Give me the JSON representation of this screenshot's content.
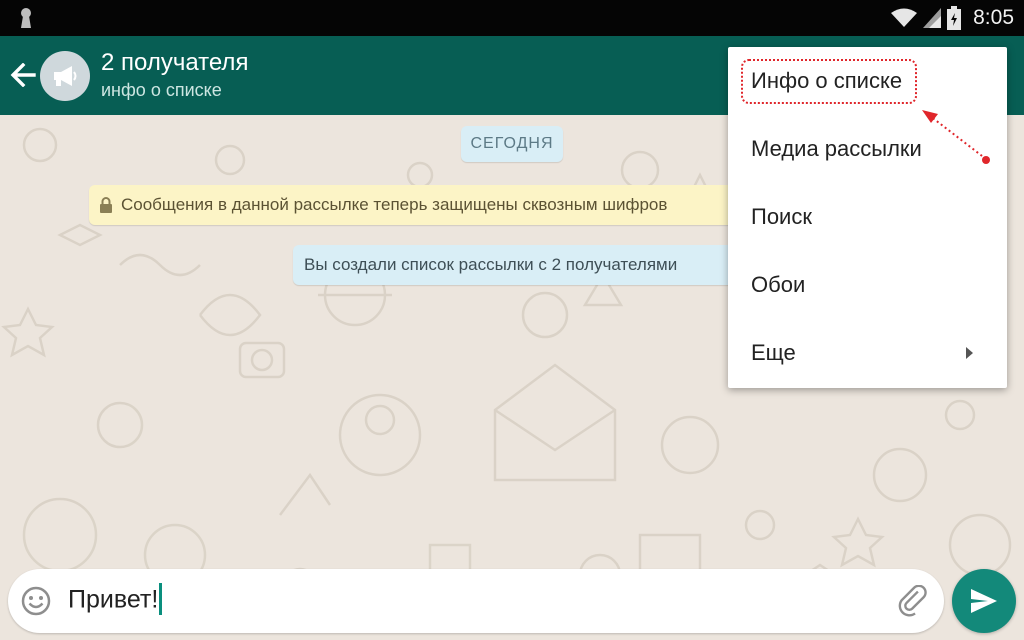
{
  "status_bar": {
    "time": "8:05",
    "icons": [
      "keyhole-icon",
      "wifi-icon",
      "signal-icon",
      "battery-icon"
    ]
  },
  "toolbar": {
    "back_icon": "arrow-left-icon",
    "avatar_icon": "broadcast-megaphone-icon",
    "title": "2 получателя",
    "subtitle": "инфо о списке"
  },
  "chat": {
    "date_chip": "СЕГОДНЯ",
    "encryption_notice": "Сообщения в данной рассылке теперь защищены сквозным шифров",
    "system_message": "Вы создали список рассылки с 2 получателями"
  },
  "input": {
    "value": "Привет!",
    "emoji_icon": "emoji-smile-icon",
    "attach_icon": "paperclip-icon",
    "send_icon": "send-arrow-icon"
  },
  "menu": {
    "items": [
      {
        "label": "Инфо о списке",
        "highlighted": true
      },
      {
        "label": "Медиа рассылки"
      },
      {
        "label": "Поиск"
      },
      {
        "label": "Обои"
      },
      {
        "label": "Еще",
        "submenu": true
      }
    ]
  },
  "colors": {
    "toolbar": "#075e54",
    "accent": "#13897a",
    "annotation": "#e0262b",
    "chat_background": "#ece5dd"
  }
}
